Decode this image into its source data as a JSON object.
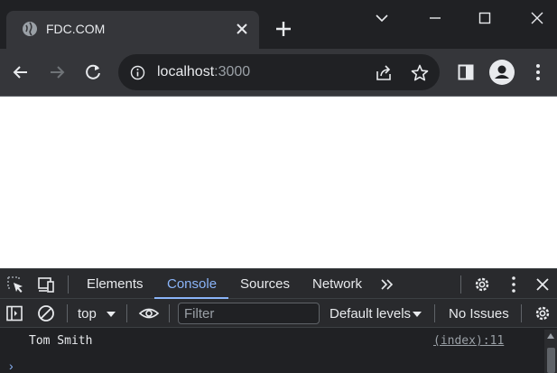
{
  "window": {
    "tab_title": "FDC.COM",
    "controls": [
      "chevron-down-icon",
      "minimize-icon",
      "maximize-icon",
      "close-icon"
    ]
  },
  "toolbar": {
    "url_host": "localhost",
    "url_port": ":3000"
  },
  "devtools": {
    "tabs": [
      "Elements",
      "Console",
      "Sources",
      "Network"
    ],
    "active_tab": "Console",
    "context": "top",
    "filter_placeholder": "Filter",
    "levels": "Default levels",
    "issues": "No Issues",
    "console": {
      "message": "Tom Smith",
      "source": "(index):11",
      "prompt": "›"
    }
  },
  "colors": {
    "frame": "#202124",
    "toolbar": "#35363a",
    "accent": "#8ab4f8"
  }
}
